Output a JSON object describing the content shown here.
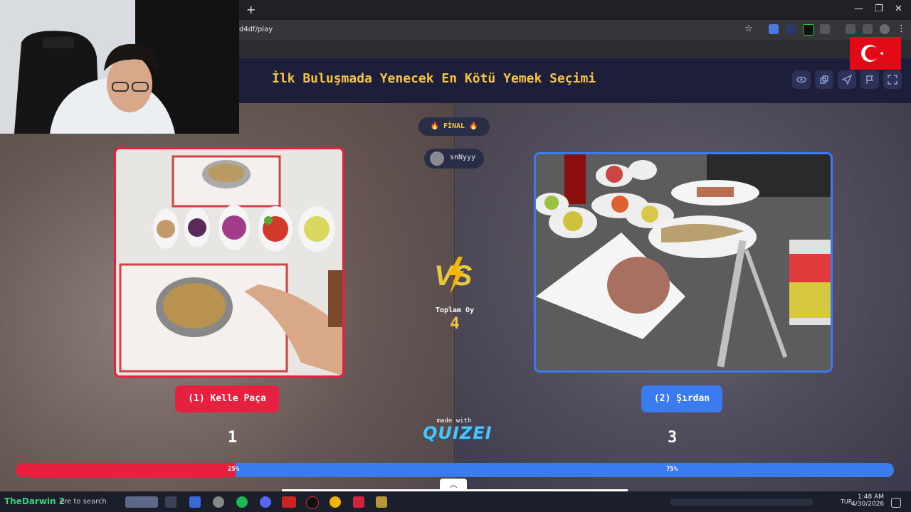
{
  "browser": {
    "new_tab_symbol": "+",
    "url": "d4df/play",
    "window_controls": [
      "—",
      "❐",
      "✕"
    ]
  },
  "quiz": {
    "title": "İlk Buluşmada Yenecek En Kötü Yemek Seçimi",
    "round_label": "🔥 FİNAL 🔥",
    "username": "snNyyy",
    "total_label": "Toplam Oy",
    "total_votes": "4",
    "header_icons": [
      "eye-icon",
      "share-icon",
      "send-icon",
      "flag-icon",
      "fullscreen-icon"
    ],
    "left": {
      "label": "(1) Kelle Paça",
      "votes": "1",
      "percent": "25%",
      "percent_value": 25,
      "color": "#e8203f"
    },
    "right": {
      "label": "(2) Şırdan",
      "votes": "3",
      "percent": "75%",
      "percent_value": 75,
      "color": "#3a7bf0"
    },
    "made_with": "made with",
    "brand": "QUIZEI",
    "expand_symbol": "︿"
  },
  "overlay": {
    "flag": "Turkey flag"
  },
  "taskbar": {
    "streamer": "TheDarwin 2",
    "search_placeholder": "ere to search",
    "language": "TUR",
    "time": "1:48 AM",
    "date": "4/30/2026"
  },
  "colors": {
    "accent_yellow": "#f4c542",
    "left_red": "#e8203f",
    "right_blue": "#3a7bf0",
    "header_bg": "#1c1e3a"
  }
}
